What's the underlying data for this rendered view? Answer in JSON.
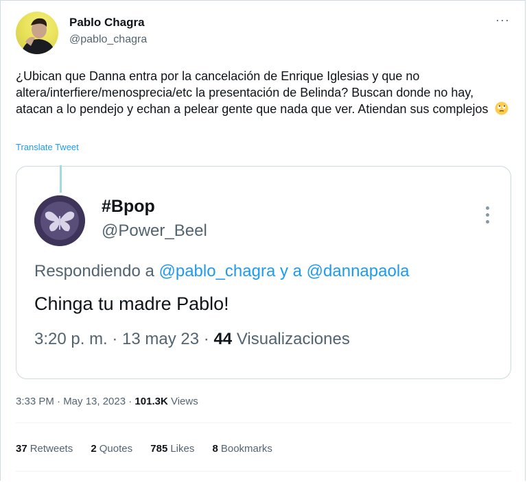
{
  "author": {
    "name": "Pablo Chagra",
    "handle": "@pablo_chagra",
    "avatar_icon": "profile-photo"
  },
  "tweet": {
    "text": "¿Ubican que Danna entra por la cancelación de Enrique Iglesias y que no altera/interfiere/menosprecia/etc la presentación de Belinda? Buscan donde no hay, atacan a lo pendejo y echan a pelear gente que nada que ver. Atiendan sus complejos",
    "emoji": "face-with-rolling-eyes-emoji",
    "translate_label": "Translate Tweet"
  },
  "quote": {
    "name": "#Bpop",
    "handle": "@Power_Beel",
    "reply_prefix": "Respondiendo a",
    "reply_mention_1": "@pablo_chagra",
    "reply_conjunction": "y a",
    "reply_mention_2": "@dannapaola",
    "text": "Chinga tu madre Pablo!",
    "time": "3:20 p. m. · 13 may 23 ·",
    "views_count": "44",
    "views_label": "Visualizaciones",
    "accent_color": "#9fdbe0"
  },
  "meta": {
    "time": "3:33 PM · May 13, 2023 ·",
    "views_count": "101.3K",
    "views_label": "Views"
  },
  "stats": [
    {
      "count": "37",
      "label": "Retweets"
    },
    {
      "count": "2",
      "label": "Quotes"
    },
    {
      "count": "785",
      "label": "Likes"
    },
    {
      "count": "8",
      "label": "Bookmarks"
    }
  ],
  "colors": {
    "link": "#1d9bf0",
    "secondary": "#536471",
    "primary": "#0f1419"
  }
}
